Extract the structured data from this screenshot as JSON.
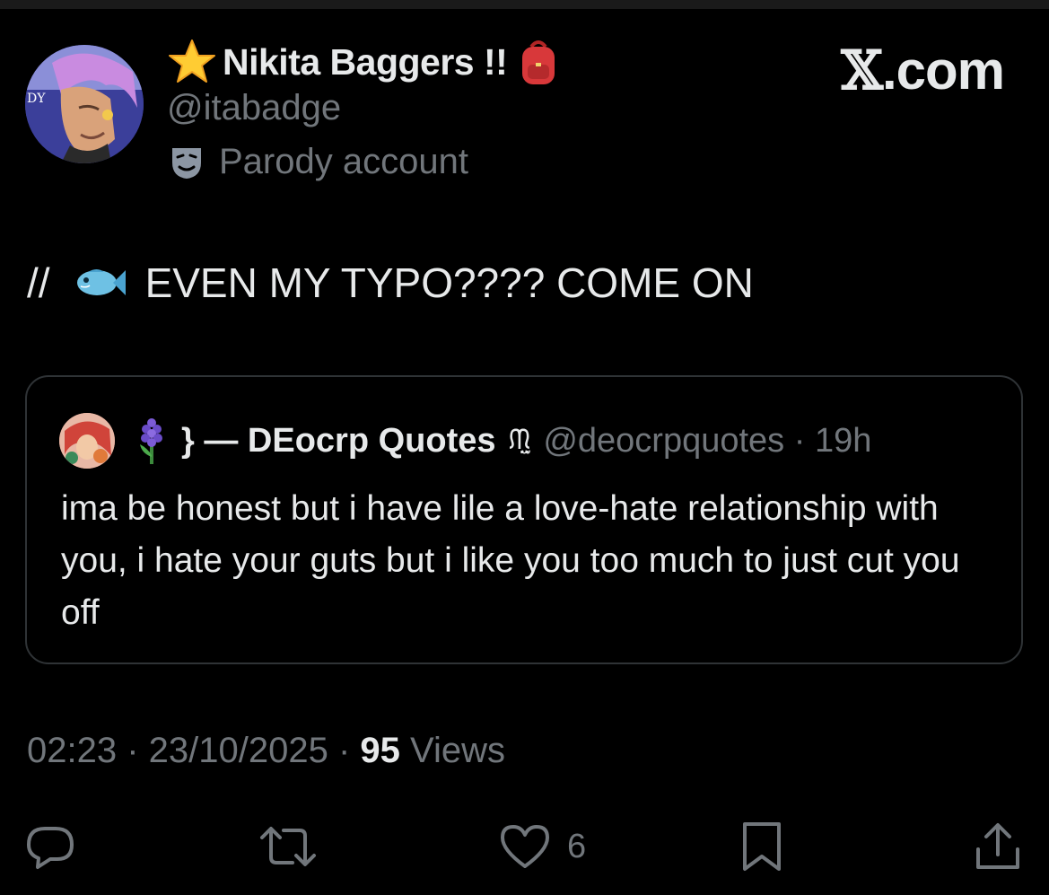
{
  "author": {
    "display_name": "Nikita Baggers !!",
    "handle": "@itabadge",
    "parody_label": "Parody account",
    "badge_icons": [
      "star-icon",
      "backpack-icon"
    ]
  },
  "brand": {
    "logo_text": ".com",
    "logo_mark": "𝕏"
  },
  "tweet": {
    "prefix": "//",
    "emoji": "fish-icon",
    "text": "EVEN MY TYPO???? COME ON"
  },
  "quote": {
    "name": "} — DEocrp Quotes",
    "kaomoji": "ᙏ̤̫",
    "handle_time": "@deocrpquotes · 19h",
    "body": "ima be honest but i have lile a love-hate relationship with you, i hate your guts but i like you too much to just cut you off"
  },
  "meta": {
    "time_date": "02:23 · 23/10/2025 · ",
    "views_count": "95",
    "views_label": " Views"
  },
  "actions": {
    "like_count": "6"
  },
  "colors": {
    "background": "#000000",
    "text_primary": "#e7e9ea",
    "text_secondary": "#71767b",
    "border": "#2f3336"
  }
}
